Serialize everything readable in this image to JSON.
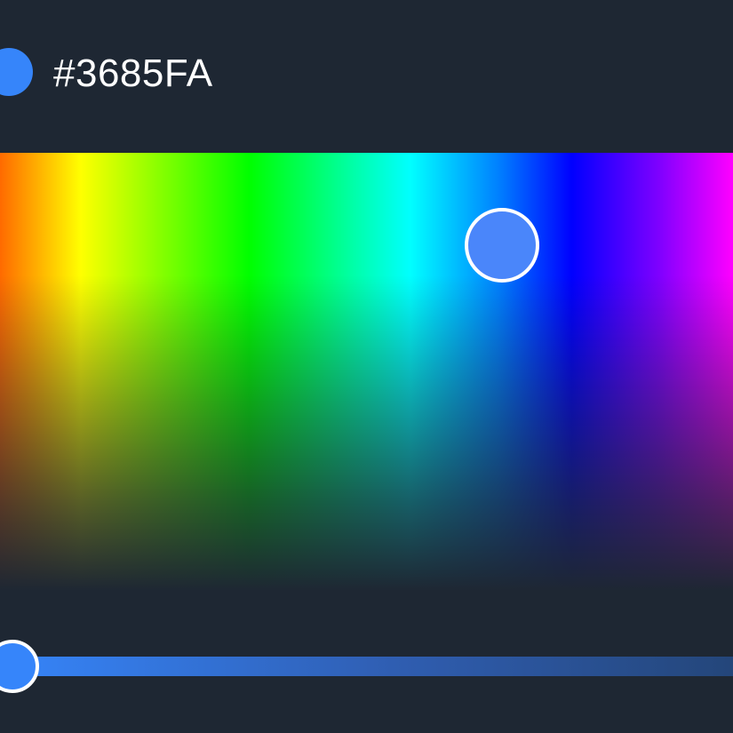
{
  "color_picker": {
    "hex_value": "#3685FA",
    "selected_color": "#3685FA",
    "slider_level": 0
  },
  "icons": {
    "swatch": "color-swatch",
    "spectrum_handle": "picker-handle",
    "slider_thumb": "slider-thumb"
  }
}
